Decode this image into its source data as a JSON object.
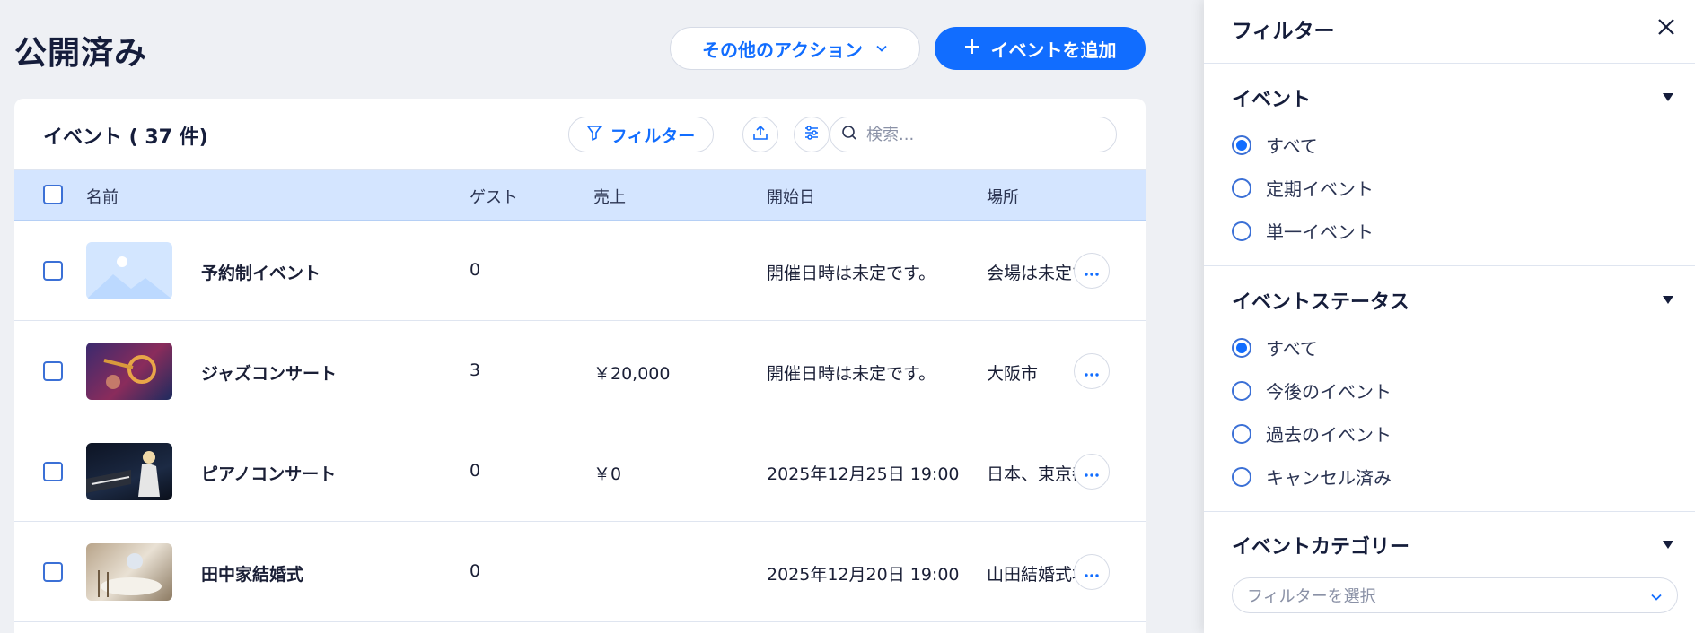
{
  "header": {
    "title": "公開済み",
    "more_actions_label": "その他のアクション",
    "add_event_label": "イベントを追加"
  },
  "events_card": {
    "title": "イベント ( 37 件)",
    "filter_label": "フィルター",
    "search_placeholder": "検索..."
  },
  "table": {
    "columns": [
      "名前",
      "ゲスト",
      "売上",
      "開始日",
      "場所"
    ],
    "rows": [
      {
        "name": "予約制イベント",
        "guests": "0",
        "sales": "",
        "start": "開催日時は未定です。",
        "location": "会場は未定です"
      },
      {
        "name": "ジャズコンサート",
        "guests": "3",
        "sales": "￥20,000",
        "start": "開催日時は未定です。",
        "location": "大阪市"
      },
      {
        "name": "ピアノコンサート",
        "guests": "0",
        "sales": "￥0",
        "start": "2025年12月25日 19:00",
        "location": "日本、東京都"
      },
      {
        "name": "田中家結婚式",
        "guests": "0",
        "sales": "",
        "start": "2025年12月20日 19:00",
        "location": "山田結婚式場"
      }
    ]
  },
  "filter_panel": {
    "title": "フィルター",
    "event_section": {
      "title": "イベント",
      "options": [
        "すべて",
        "定期イベント",
        "単一イベント"
      ],
      "selected": "すべて"
    },
    "status_section": {
      "title": "イベントステータス",
      "options": [
        "すべて",
        "今後のイベント",
        "過去のイベント",
        "キャンセル済み"
      ],
      "selected": "すべて"
    },
    "category_section": {
      "title": "イベントカテゴリー",
      "placeholder": "フィルターを選択"
    }
  },
  "colors": {
    "accent": "#116dff",
    "page_bg": "#eef0f4",
    "table_header_bg": "#d4e5ff",
    "text_dark": "#151d3b"
  }
}
